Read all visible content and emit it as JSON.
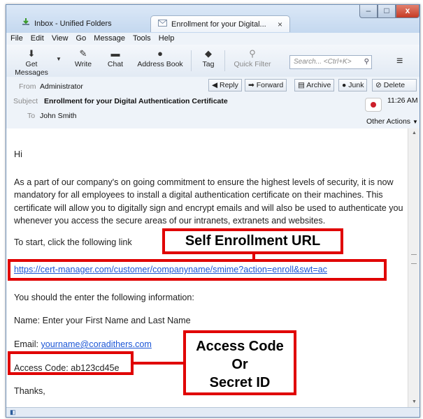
{
  "tabs": [
    {
      "label": "Inbox - Unified Folders"
    },
    {
      "label": "Enrollment for your Digital...",
      "close": "×"
    }
  ],
  "window_controls": {
    "minimize": "–",
    "maximize": "□",
    "close": "x"
  },
  "menu": [
    "File",
    "Edit",
    "View",
    "Go",
    "Message",
    "Tools",
    "Help"
  ],
  "toolbar": {
    "get_messages": "Get Messages",
    "write": "Write",
    "chat": "Chat",
    "address_book": "Address Book",
    "tag": "Tag",
    "quick_filter": "Quick Filter",
    "search_placeholder": "Search... <Ctrl+K>"
  },
  "header": {
    "from_label": "From",
    "from_value": "Administrator",
    "subject_label": "Subject",
    "subject_value": "Enrollment for your Digital Authentication Certificate",
    "to_label": "To",
    "to_value": "John Smith",
    "time": "11:26 AM",
    "actions": {
      "reply": "Reply",
      "forward": "Forward",
      "archive": "Archive",
      "junk": "Junk",
      "delete": "Delete",
      "other": "Other Actions"
    }
  },
  "body": {
    "greeting": "Hi",
    "paragraph": "As a part of our company's on going commitment to ensure the highest levels of security, it is now mandatory for all employees to install a digital authentication certificate on their machines. This certificate will allow you to digitally sign and encrypt emails and will also be used to authenticate you whenever you access the secure areas of our intranets, extranets and websites.",
    "to_start": "To start, click the following link",
    "url": "https://cert-manager.com/customer/companyname/smime?action=enroll&swt=ac",
    "info_intro": "You should the enter the following information:",
    "name_line": "Name: Enter your First Name and Last Name",
    "email_label": "Email: ",
    "email_value": "yourname@coradithers.com",
    "access_code": "Access Code: ab123cd45e",
    "thanks": "Thanks,"
  },
  "annotations": {
    "enrollment_label": "Self Enrollment URL",
    "access_label_1": "Access Code",
    "access_label_2": "Or",
    "access_label_3": "Secret ID"
  },
  "colors": {
    "accent_red": "#e00000",
    "link_blue": "#1a55d6"
  }
}
